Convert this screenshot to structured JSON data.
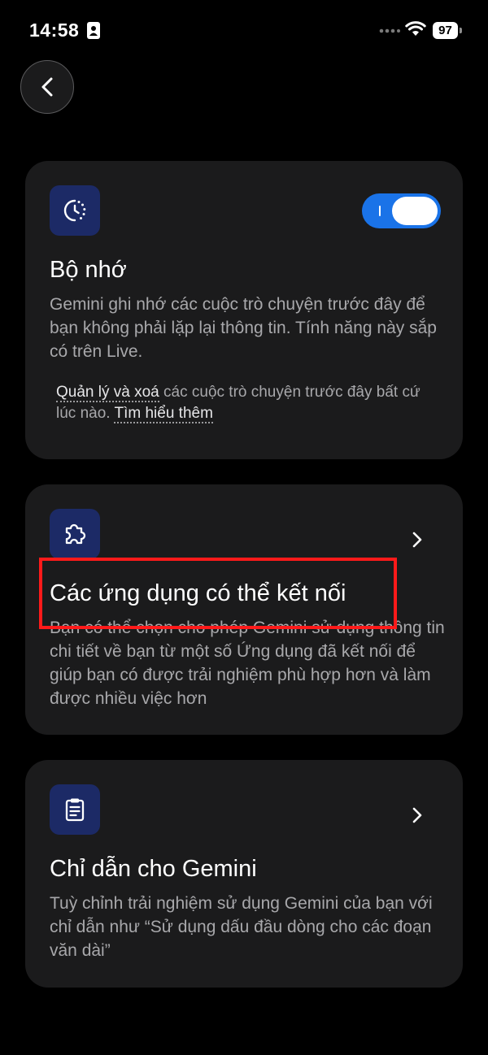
{
  "status_bar": {
    "time": "14:58",
    "battery": "97",
    "icons": [
      "id-card-icon",
      "dots-icon",
      "wifi-icon",
      "battery-icon"
    ]
  },
  "back_button": {
    "icon": "chevron-left-icon"
  },
  "memory_card": {
    "icon": "history-clock-icon",
    "toggle_on": true,
    "title": "Bộ nhớ",
    "description": "Gemini ghi nhớ các cuộc trò chuyện trước đây để bạn không phải lặp lại thông tin. Tính năng này sắp có trên Live.",
    "manage_link": "Quản lý và xoá",
    "footer_text": " các cuộc trò chuyện trước đây bất cứ lúc nào. ",
    "learn_more_link": "Tìm hiểu thêm"
  },
  "apps_card": {
    "icon": "puzzle-icon",
    "title": "Các ứng dụng có thể kết nối",
    "description": "Bạn có thể chọn cho phép Gemini sử dụng thông tin chi tiết về bạn từ một số Ứng dụng đã kết nối để giúp bạn có được trải nghiệm phù hợp hơn và làm được nhiều việc hơn"
  },
  "instructions_card": {
    "icon": "clipboard-icon",
    "title": "Chỉ dẫn cho Gemini",
    "description": "Tuỳ chỉnh trải nghiệm sử dụng Gemini của bạn với chỉ dẫn như “Sử dụng dấu đầu dòng cho các đoạn văn dài”"
  },
  "colors": {
    "background": "#000000",
    "card": "#1b1b1c",
    "icon_bg": "#1c2a66",
    "toggle_on": "#1a73e8",
    "highlight": "#ff1a1a"
  }
}
